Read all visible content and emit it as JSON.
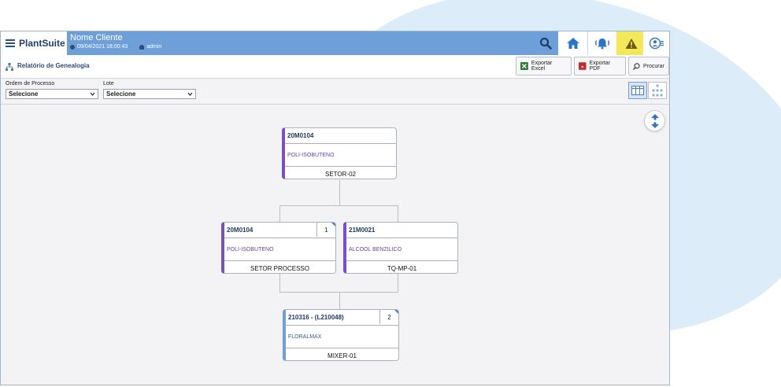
{
  "app": {
    "logo_text": "PlantSuite",
    "client_name": "Nome Cliente",
    "datetime": "09/04/2021 18:00:43",
    "user": "admin",
    "accent_color": "#6f9fd8",
    "alert_color": "#f2e85a"
  },
  "page": {
    "title": "Relatório de Genealogia",
    "buttons": {
      "export_excel": "Exportar Excel",
      "export_pdf": "Exportar PDF",
      "search": "Procurar"
    }
  },
  "filters": {
    "order_label": "Ordem de Processo",
    "order_value": "Selecione",
    "lot_label": "Lote",
    "lot_value": "Selecione"
  },
  "nodes": {
    "n1": {
      "id": "20M0104",
      "product": "POLI-ISOBUTENO",
      "equipment": "SETOR-02",
      "count": ""
    },
    "n2": {
      "id": "20M0104",
      "product": "POLI-ISOBUTENO",
      "equipment": "SETOR PROCESSO",
      "count": "1"
    },
    "n3": {
      "id": "21M0021",
      "product": "ALCOOL BENZILICO",
      "equipment": "TQ-MP-01",
      "count": ""
    },
    "n4": {
      "id": "210316 - (L210048)",
      "product": "FLORALMAX",
      "equipment": "MIXER-01",
      "count": "2"
    }
  },
  "icons": [
    "menu-icon",
    "clock-icon",
    "user-icon",
    "search-icon",
    "home-icon",
    "bell-icon",
    "warning-icon",
    "profile-list-icon",
    "tree-icon",
    "excel-icon",
    "pdf-icon",
    "magnifier-icon",
    "chevron-down-icon",
    "table-view-icon",
    "graph-view-icon",
    "expand-vertical-icon"
  ]
}
